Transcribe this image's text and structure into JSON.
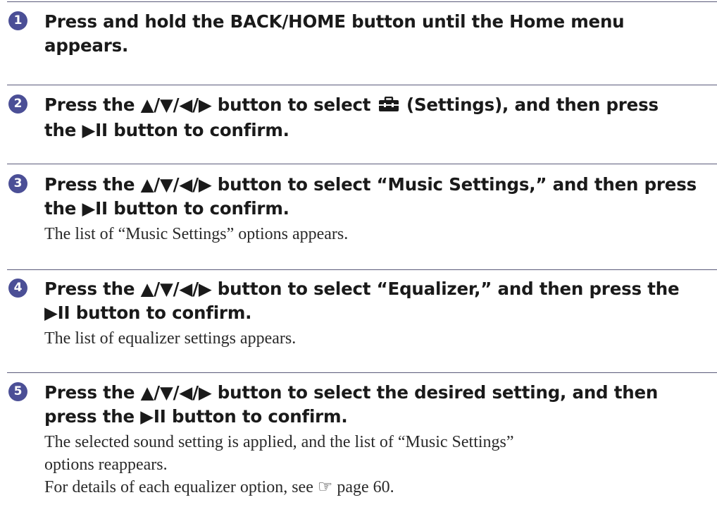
{
  "steps": [
    {
      "number": "1",
      "heading_lines": [
        "Press and hold the BACK/HOME button until the Home menu",
        "appears."
      ],
      "body_lines": []
    },
    {
      "number": "2",
      "heading_pre": "Press the ▲/▼/◀/▶ button to select ",
      "heading_post": " (Settings), and then press",
      "heading_line2": "the ▶II button to confirm.",
      "icon": "settings-toolbox-icon",
      "body_lines": []
    },
    {
      "number": "3",
      "heading_lines": [
        "Press the ▲/▼/◀/▶ button to select “Music Settings,” and then press",
        "the ▶II button to confirm."
      ],
      "body_lines": [
        "The list of “Music Settings” options appears."
      ]
    },
    {
      "number": "4",
      "heading_lines": [
        "Press the ▲/▼/◀/▶ button to select “Equalizer,” and then press the",
        "▶II button to confirm."
      ],
      "body_lines": [
        "The list of equalizer settings appears."
      ]
    },
    {
      "number": "5",
      "heading_lines": [
        "Press the ▲/▼/◀/▶ button to select the desired setting, and then",
        "press the ▶II button to confirm."
      ],
      "body_lines": [
        "The selected sound setting is applied, and the list of “Music Settings”",
        "options reappears.",
        "For details of each equalizer option, see ☞ page 60."
      ]
    }
  ],
  "colors": {
    "step_badge": "#4b4f96",
    "divider": "#5a5a7a"
  }
}
